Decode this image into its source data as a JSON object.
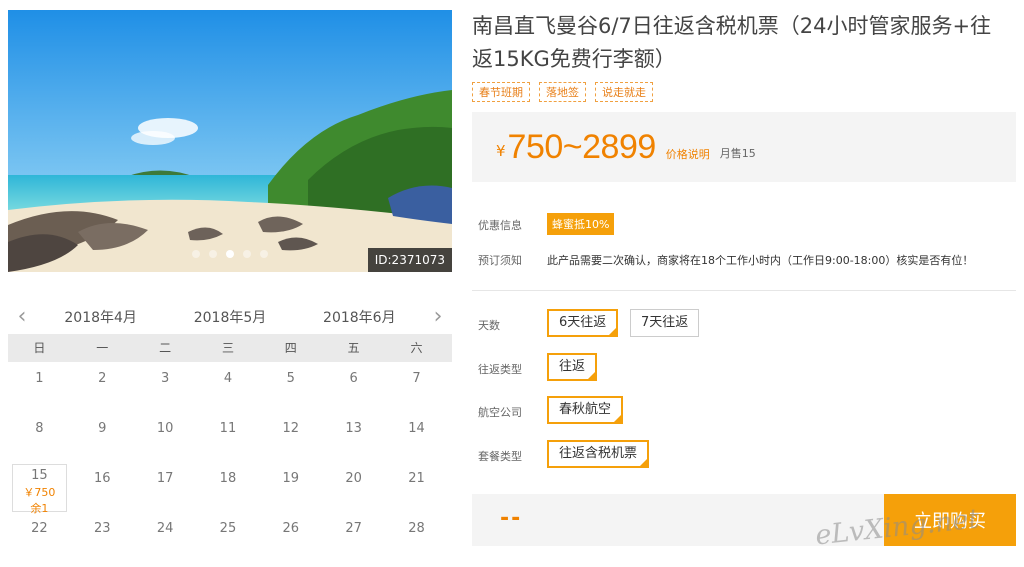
{
  "hero": {
    "id_label": "ID:2371073",
    "slide_count": 5,
    "active_slide": 2
  },
  "calendar": {
    "prev_icon": "chevron-left-icon",
    "next_icon": "chevron-right-icon",
    "months": [
      "2018年4月",
      "2018年5月",
      "2018年6月"
    ],
    "weekdays": [
      "日",
      "一",
      "二",
      "三",
      "四",
      "五",
      "六"
    ],
    "rows": [
      [
        "1",
        "2",
        "3",
        "4",
        "5",
        "6",
        "7"
      ],
      [
        "8",
        "9",
        "10",
        "11",
        "12",
        "13",
        "14"
      ],
      [
        "15",
        "16",
        "17",
        "18",
        "19",
        "20",
        "21"
      ],
      [
        "22",
        "23",
        "24",
        "25",
        "26",
        "27",
        "28"
      ]
    ],
    "selected": {
      "day": "15",
      "price": "￥750",
      "left": "余1"
    }
  },
  "product": {
    "title": "南昌直飞曼谷6/7日往返含税机票（24小时管家服务+往返15KG免费行李额）",
    "tags": [
      "春节班期",
      "落地签",
      "说走就走"
    ]
  },
  "price": {
    "currency": "¥",
    "range": "750~2899",
    "note": "价格说明",
    "sold": "月售15"
  },
  "info": {
    "discount_label": "优惠信息",
    "discount_value": "蜂蜜抵10%",
    "notice_label": "预订须知",
    "notice_text": "此产品需要二次确认，商家将在18个工作小时内（工作日9:00-18:00）核实是否有位！"
  },
  "options": {
    "days_label": "天数",
    "days": [
      "6天往返",
      "7天往返"
    ],
    "trip_label": "往返类型",
    "trip": "往返",
    "airline_label": "航空公司",
    "airline": "春秋航空",
    "package_label": "套餐类型",
    "package": "往返含税机票"
  },
  "buy": {
    "total": "--",
    "button": "立即购买"
  },
  "watermark": "eLvXing.net",
  "colors": {
    "accent": "#f5a00a",
    "price": "#f08200"
  }
}
